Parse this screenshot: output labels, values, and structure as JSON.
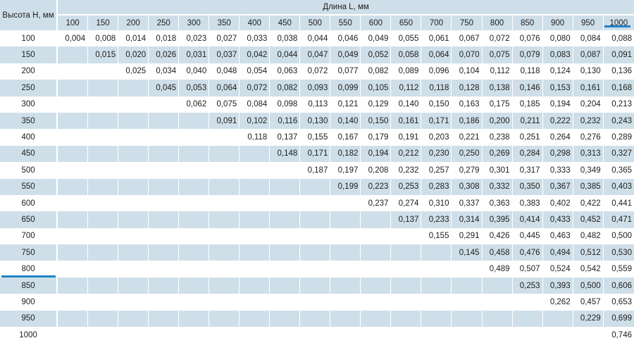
{
  "table": {
    "row_header_label": "Высота H, мм",
    "col_group_label": "Длина L, мм",
    "columns": [
      "100",
      "150",
      "200",
      "250",
      "300",
      "350",
      "400",
      "450",
      "500",
      "550",
      "600",
      "650",
      "700",
      "750",
      "800",
      "850",
      "900",
      "950",
      "1000"
    ],
    "rows": [
      {
        "h": "100",
        "values": [
          "0,004",
          "0,008",
          "0,014",
          "0,018",
          "0,023",
          "0,027",
          "0,033",
          "0,038",
          "0,044",
          "0,046",
          "0,049",
          "0,055",
          "0,061",
          "0,067",
          "0,072",
          "0,076",
          "0,080",
          "0,084",
          "0,088"
        ]
      },
      {
        "h": "150",
        "values": [
          "",
          "0,015",
          "0,020",
          "0,026",
          "0,031",
          "0,037",
          "0,042",
          "0,044",
          "0,047",
          "0,049",
          "0,052",
          "0,058",
          "0,064",
          "0,070",
          "0,075",
          "0,079",
          "0,083",
          "0,087",
          "0,091"
        ]
      },
      {
        "h": "200",
        "values": [
          "",
          "",
          "0,025",
          "0,034",
          "0,040",
          "0,048",
          "0,054",
          "0,063",
          "0,072",
          "0,077",
          "0,082",
          "0,089",
          "0,096",
          "0,104",
          "0,112",
          "0,118",
          "0,124",
          "0,130",
          "0,136"
        ]
      },
      {
        "h": "250",
        "values": [
          "",
          "",
          "",
          "0,045",
          "0,053",
          "0,064",
          "0,072",
          "0,082",
          "0,093",
          "0,099",
          "0,105",
          "0,112",
          "0,118",
          "0,128",
          "0,138",
          "0,146",
          "0,153",
          "0,161",
          "0,168"
        ]
      },
      {
        "h": "300",
        "values": [
          "",
          "",
          "",
          "",
          "0,062",
          "0,075",
          "0,084",
          "0,098",
          "0,113",
          "0,121",
          "0,129",
          "0,140",
          "0,150",
          "0,163",
          "0,175",
          "0,185",
          "0,194",
          "0,204",
          "0,213"
        ]
      },
      {
        "h": "350",
        "values": [
          "",
          "",
          "",
          "",
          "",
          "0,091",
          "0,102",
          "0,116",
          "0,130",
          "0,140",
          "0,150",
          "0,161",
          "0,171",
          "0,186",
          "0,200",
          "0,211",
          "0,222",
          "0,232",
          "0,243"
        ]
      },
      {
        "h": "400",
        "values": [
          "",
          "",
          "",
          "",
          "",
          "",
          "0,118",
          "0,137",
          "0,155",
          "0,167",
          "0,179",
          "0,191",
          "0,203",
          "0,221",
          "0,238",
          "0,251",
          "0,264",
          "0,276",
          "0,289"
        ]
      },
      {
        "h": "450",
        "values": [
          "",
          "",
          "",
          "",
          "",
          "",
          "",
          "0,148",
          "0,171",
          "0,182",
          "0,194",
          "0,212",
          "0,230",
          "0,250",
          "0,269",
          "0,284",
          "0,298",
          "0,313",
          "0,327"
        ]
      },
      {
        "h": "500",
        "values": [
          "",
          "",
          "",
          "",
          "",
          "",
          "",
          "",
          "0,187",
          "0,197",
          "0,208",
          "0,232",
          "0,257",
          "0,279",
          "0,301",
          "0,317",
          "0,333",
          "0,349",
          "0,365"
        ]
      },
      {
        "h": "550",
        "values": [
          "",
          "",
          "",
          "",
          "",
          "",
          "",
          "",
          "",
          "0,199",
          "0,223",
          "0,253",
          "0,283",
          "0,308",
          "0,332",
          "0,350",
          "0,367",
          "0,385",
          "0,403"
        ]
      },
      {
        "h": "600",
        "values": [
          "",
          "",
          "",
          "",
          "",
          "",
          "",
          "",
          "",
          "",
          "0,237",
          "0,274",
          "0,310",
          "0,337",
          "0,363",
          "0,383",
          "0,402",
          "0,422",
          "0,441"
        ]
      },
      {
        "h": "650",
        "values": [
          "",
          "",
          "",
          "",
          "",
          "",
          "",
          "",
          "",
          "",
          "",
          "0,137",
          "0,233",
          "0,314",
          "0,395",
          "0,414",
          "0,433",
          "0,452",
          "0,471"
        ]
      },
      {
        "h": "700",
        "values": [
          "",
          "",
          "",
          "",
          "",
          "",
          "",
          "",
          "",
          "",
          "",
          "",
          "0,155",
          "0,291",
          "0,426",
          "0,445",
          "0,463",
          "0,482",
          "0,500"
        ]
      },
      {
        "h": "750",
        "values": [
          "",
          "",
          "",
          "",
          "",
          "",
          "",
          "",
          "",
          "",
          "",
          "",
          "",
          "0,145",
          "0,458",
          "0,476",
          "0,494",
          "0,512",
          "0,530"
        ]
      },
      {
        "h": "800",
        "values": [
          "",
          "",
          "",
          "",
          "",
          "",
          "",
          "",
          "",
          "",
          "",
          "",
          "",
          "",
          "0,489",
          "0,507",
          "0,524",
          "0,542",
          "0,559"
        ]
      },
      {
        "h": "850",
        "values": [
          "",
          "",
          "",
          "",
          "",
          "",
          "",
          "",
          "",
          "",
          "",
          "",
          "",
          "",
          "",
          "0,253",
          "0,393",
          "0,500",
          "0,606"
        ]
      },
      {
        "h": "900",
        "values": [
          "",
          "",
          "",
          "",
          "",
          "",
          "",
          "",
          "",
          "",
          "",
          "",
          "",
          "",
          "",
          "",
          "0,262",
          "0,457",
          "0,653"
        ]
      },
      {
        "h": "950",
        "values": [
          "",
          "",
          "",
          "",
          "",
          "",
          "",
          "",
          "",
          "",
          "",
          "",
          "",
          "",
          "",
          "",
          "",
          "0,229",
          "0,699"
        ]
      },
      {
        "h": "1000",
        "values": [
          "",
          "",
          "",
          "",
          "",
          "",
          "",
          "",
          "",
          "",
          "",
          "",
          "",
          "",
          "",
          "",
          "",
          "",
          "0,746"
        ]
      }
    ],
    "highlight": {
      "column": "1000",
      "row": "800",
      "color": "#1f84c9"
    },
    "band_color": "#cfdfe9"
  }
}
